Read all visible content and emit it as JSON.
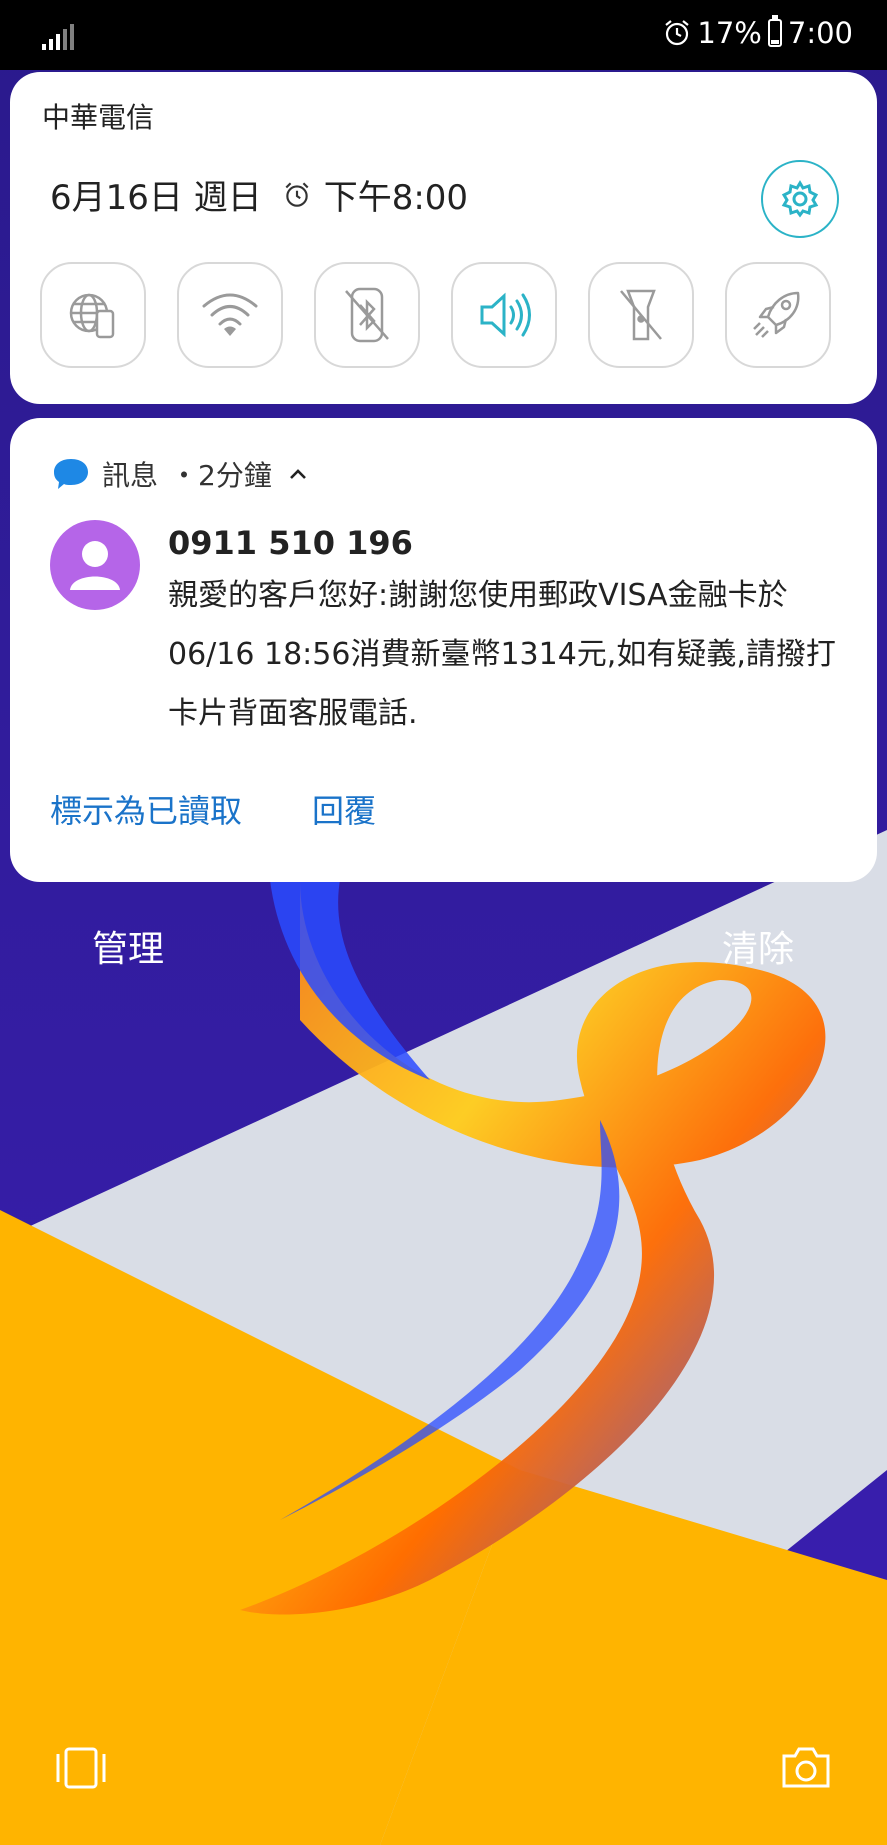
{
  "status_bar": {
    "battery": "17%",
    "time": "7:00"
  },
  "quick_settings": {
    "carrier": "中華電信",
    "date": "6月16日 週日",
    "alarm": "下午8:00",
    "tiles": [
      {
        "icon": "globe-phone-icon"
      },
      {
        "icon": "wifi-icon"
      },
      {
        "icon": "bluetooth-off-icon"
      },
      {
        "icon": "sound-on-icon"
      },
      {
        "icon": "flashlight-off-icon"
      },
      {
        "icon": "rocket-icon"
      }
    ],
    "accent": "#2bb3c7"
  },
  "notification": {
    "app": "訊息",
    "time_sep": "・",
    "time_ago": "2分鐘",
    "sender": "0911 510 196",
    "body": "親愛的客戶您好:謝謝您使用郵政VISA金融卡於06/16 18:56消費新臺幣1314元,如有疑義,請撥打卡片背面客服電話.",
    "actions": {
      "mark_read": "標示為已讀取",
      "reply": "回覆"
    },
    "action_color": "#1a73c9",
    "avatar_color": "#b565e8"
  },
  "footer": {
    "manage": "管理",
    "clear": "清除"
  }
}
